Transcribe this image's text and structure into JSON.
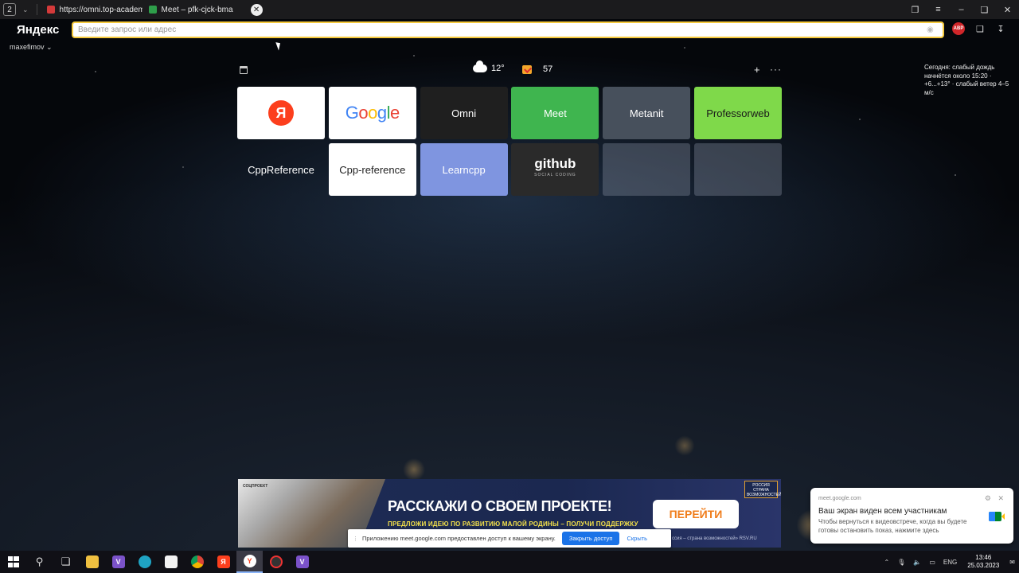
{
  "tabbar": {
    "tab_count": "2",
    "tabs": [
      {
        "label": "https://omni.top-academy"
      },
      {
        "label": "Meet – pfk-cjck-bma"
      }
    ]
  },
  "toolbar": {
    "logo": "Яндекс",
    "omnibox_placeholder": "Введите запрос или адрес",
    "user": "maxefimov",
    "abp_label": "ABP"
  },
  "widgets": {
    "weather_temp": "12°",
    "mail_count": "57",
    "forecast": "Сегодня: слабый дождь начнётся около 15:20 · +6...+13° · слабый ветер 4–5 м/с"
  },
  "tiles": [
    {
      "label": "Я",
      "kind": "yandex",
      "bg": "#ffffff"
    },
    {
      "label": "Google",
      "kind": "google",
      "bg": "#ffffff"
    },
    {
      "label": "Omni",
      "kind": "text",
      "bg": "#1f1f1f",
      "color": "#ffffff"
    },
    {
      "label": "Meet",
      "kind": "text",
      "bg": "#3fb54f",
      "color": "#ffffff"
    },
    {
      "label": "Metanit",
      "kind": "text",
      "bg": "#47505c",
      "color": "#ffffff"
    },
    {
      "label": "Professorweb",
      "kind": "text",
      "bg": "#7fd94a",
      "color": "#1a1a1a"
    },
    {
      "label": "CppReference",
      "kind": "text",
      "bg": "transparent",
      "color": "#ffffff"
    },
    {
      "label": "Cpp-reference",
      "kind": "text",
      "bg": "#ffffff",
      "color": "#222222"
    },
    {
      "label": "Learncpp",
      "kind": "text",
      "bg": "#7f95e0",
      "color": "#ffffff"
    },
    {
      "label": "github",
      "kind": "github",
      "sub": "SOCIAL CODING",
      "bg": "#2a2a2a"
    },
    {
      "label": "",
      "kind": "empty",
      "bg": "rgba(140,150,165,0.35)"
    },
    {
      "label": "",
      "kind": "empty",
      "bg": "rgba(140,150,165,0.35)"
    }
  ],
  "banner": {
    "tiny": "СОЦПРОЕКТ",
    "title": "РАССКАЖИ О СВОЕМ ПРОЕКТЕ!",
    "subtitle": "ПРЕДЛОЖИ ИДЕЮ ПО РАЗВИТИЮ МАЛОЙ РОДИНЫ – ПОЛУЧИ ПОДДЕРЖКУ",
    "button": "ПЕРЕЙТИ",
    "footer": "ссия – страна возможностей» RSV.RU",
    "logo_text": "РОССИЯ СТРАНА ВОЗМОЖНОСТЕЙ"
  },
  "sharebar": {
    "text": "Приложению meet.google.com предоставлен доступ к вашему экрану.",
    "stop": "Закрыть доступ",
    "hide": "Скрыть"
  },
  "notification": {
    "source": "meet.google.com",
    "title": "Ваш экран виден всем участникам",
    "body": "Чтобы вернуться к видеовстрече, когда вы будете готовы остановить показ, нажмите здесь"
  },
  "taskbar": {
    "lang": "ENG",
    "time": "13:46",
    "date": "25.03.2023"
  },
  "colors": {
    "accent": "#f5c93c",
    "yandex_red": "#fc3f1d",
    "meet_green": "#3fb54f",
    "share_blue": "#1a73e8"
  }
}
